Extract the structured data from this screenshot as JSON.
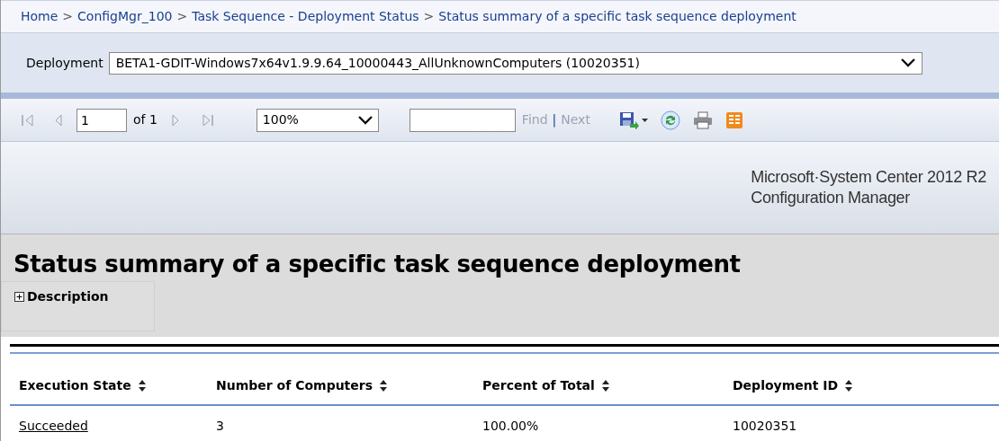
{
  "breadcrumb": {
    "separator": ">",
    "items": [
      {
        "label": "Home"
      },
      {
        "label": "ConfigMgr_100"
      },
      {
        "label": "Task Sequence - Deployment Status"
      },
      {
        "label": "Status summary of a specific task sequence deployment"
      }
    ]
  },
  "parameters": [
    {
      "label": "Deployment",
      "value": "BETA1-GDIT-Windows7x64v1.9.9.64_10000443_AllUnknownComputers (10020351)"
    }
  ],
  "toolbar": {
    "nav_buttons": [
      {
        "kind": "first",
        "disabled": true
      },
      {
        "kind": "previous",
        "disabled": true
      }
    ],
    "page": "1",
    "page_of": "of 1",
    "nav_buttons_after": [
      {
        "kind": "next",
        "disabled": true
      },
      {
        "kind": "last",
        "disabled": true
      }
    ],
    "zoom": "100%",
    "find_label": "Find",
    "find_separator": "|",
    "next_label": "Next",
    "find_disabled": true
  },
  "banner": {
    "line1": "Microsoft·System Center 2012 R2",
    "line2": "Configuration Manager"
  },
  "report": {
    "title": "Status summary of a specific task sequence deployment",
    "description": {
      "label": "Description",
      "expanded": false
    }
  },
  "table": {
    "columns": [
      {
        "label": "Execution State"
      },
      {
        "label": "Number of Computers"
      },
      {
        "label": "Percent of Total"
      },
      {
        "label": "Deployment ID"
      }
    ],
    "rows": [
      {
        "cells": [
          {
            "text": "Succeeded",
            "link": true
          },
          {
            "text": "3",
            "link": false
          },
          {
            "text": "100.00%",
            "link": false
          },
          {
            "text": "10020351",
            "link": false
          }
        ]
      }
    ]
  }
}
